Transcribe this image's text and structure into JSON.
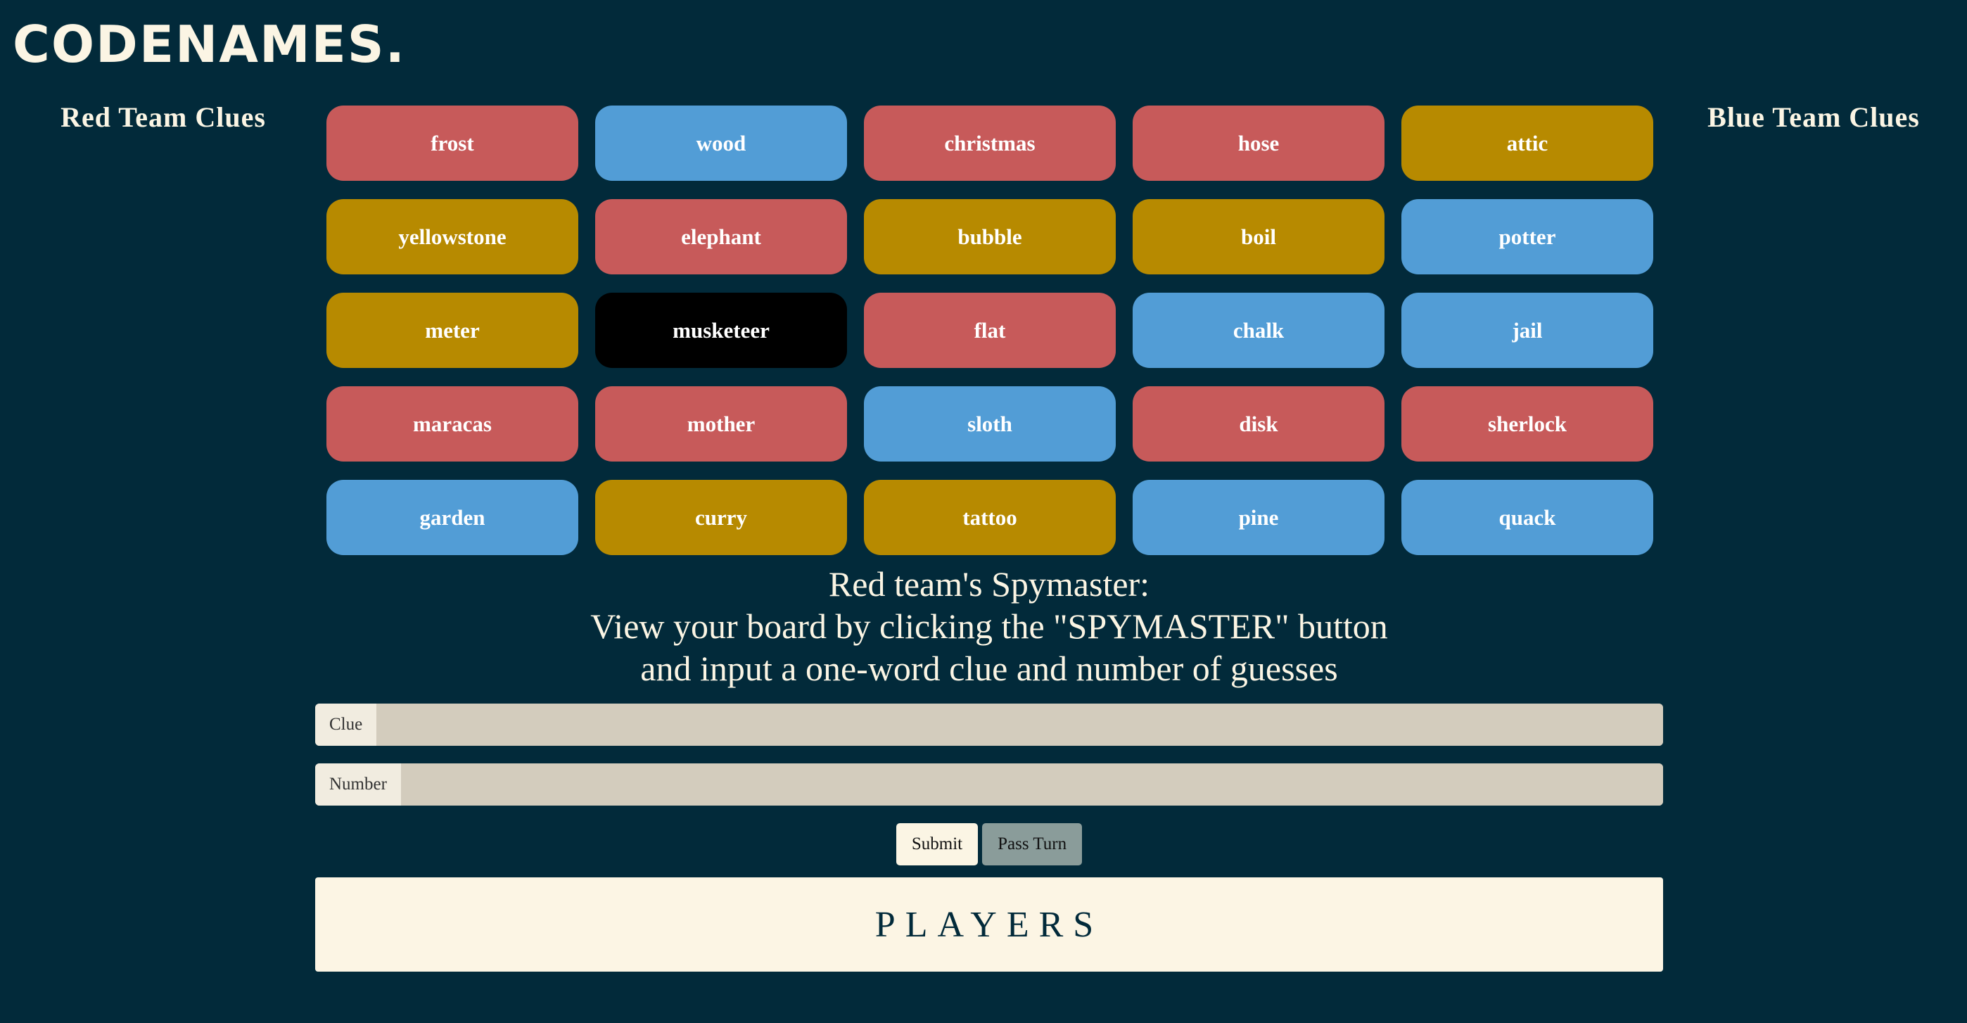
{
  "app": {
    "logo": "CODENAMES."
  },
  "clues": {
    "red_title": "Red Team Clues",
    "blue_title": "Blue Team Clues"
  },
  "board": {
    "cards": [
      {
        "word": "frost",
        "color": "red"
      },
      {
        "word": "wood",
        "color": "blue"
      },
      {
        "word": "christmas",
        "color": "red"
      },
      {
        "word": "hose",
        "color": "red"
      },
      {
        "word": "attic",
        "color": "neutral"
      },
      {
        "word": "yellowstone",
        "color": "neutral"
      },
      {
        "word": "elephant",
        "color": "red"
      },
      {
        "word": "bubble",
        "color": "neutral"
      },
      {
        "word": "boil",
        "color": "neutral"
      },
      {
        "word": "potter",
        "color": "blue"
      },
      {
        "word": "meter",
        "color": "neutral"
      },
      {
        "word": "musketeer",
        "color": "assassin"
      },
      {
        "word": "flat",
        "color": "red"
      },
      {
        "word": "chalk",
        "color": "blue"
      },
      {
        "word": "jail",
        "color": "blue"
      },
      {
        "word": "maracas",
        "color": "red"
      },
      {
        "word": "mother",
        "color": "red"
      },
      {
        "word": "sloth",
        "color": "blue"
      },
      {
        "word": "disk",
        "color": "red"
      },
      {
        "word": "sherlock",
        "color": "red"
      },
      {
        "word": "garden",
        "color": "blue"
      },
      {
        "word": "curry",
        "color": "neutral"
      },
      {
        "word": "tattoo",
        "color": "neutral"
      },
      {
        "word": "pine",
        "color": "blue"
      },
      {
        "word": "quack",
        "color": "blue"
      }
    ]
  },
  "instructions": {
    "line1": "Red team's Spymaster:",
    "line2": "View your board by clicking the \"SPYMASTER\" button",
    "line3": "and input a one-word clue and number of guesses"
  },
  "form": {
    "clue_label": "Clue",
    "clue_value": "",
    "number_label": "Number",
    "number_value": "",
    "submit_label": "Submit",
    "pass_label": "Pass Turn"
  },
  "players": {
    "title": "PLAYERS"
  },
  "colors": {
    "background": "#022a3a",
    "red": "#c75a5a",
    "blue": "#529dd6",
    "neutral": "#b78a00",
    "assassin": "#000000",
    "cream": "#fbf5e4"
  }
}
